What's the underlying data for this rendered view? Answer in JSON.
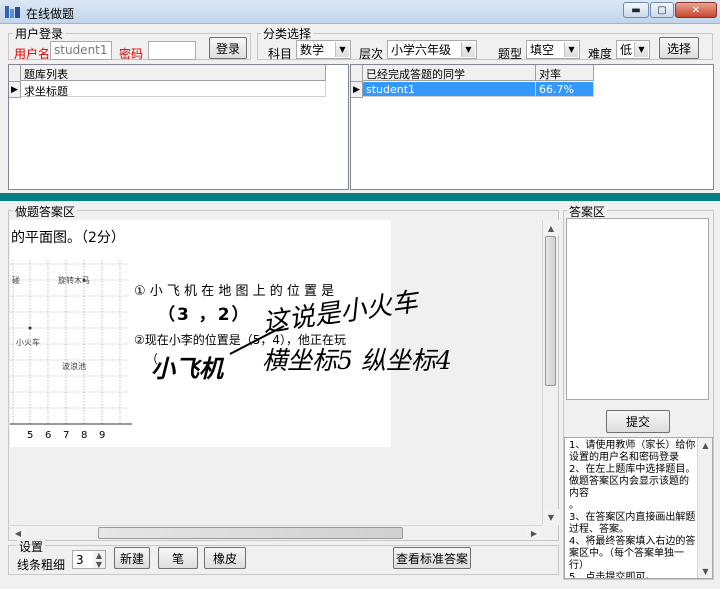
{
  "window": {
    "title": "在线做题",
    "min_glyph": "▬",
    "max_glyph": "▢",
    "close_glyph": "✕"
  },
  "login": {
    "group_label": "用户登录",
    "user_label": "用户名",
    "user_value": "student1",
    "password_label": "密码",
    "password_value": "",
    "login_button": "登录"
  },
  "filter": {
    "group_label": "分类选择",
    "subject_label": "科目",
    "subject_value": "数学",
    "level_label": "层次",
    "level_value": "小学六年级",
    "type_label": "题型",
    "type_value": "填空",
    "difficulty_label": "难度",
    "difficulty_value": "低",
    "select_button": "选择"
  },
  "question_bank": {
    "header": "题库列表",
    "rows": [
      "求坐标题"
    ]
  },
  "completed": {
    "headers": [
      "已经完成答题的同学",
      "对率"
    ],
    "rows": [
      {
        "name": "student1",
        "rate": "66.7%"
      }
    ]
  },
  "work_area": {
    "group_label": "做题答案区",
    "question_line1": "的平面图。（2分）",
    "map_label_top": "旋转木马",
    "map_label_left": "小火车",
    "map_label_mid": "波浪池",
    "map_label_corner": "碰",
    "x_ticks": [
      "5",
      "6",
      "7",
      "8",
      "9"
    ],
    "q1_text": "① 小 飞 机 在 地 图 上 的 位 置 是",
    "q1_answer": "（3 ，2）",
    "q2_text": "②现在小李的位置是（5，4），他正在玩",
    "q2_paren": "（",
    "hw_line1": "这说是小火车",
    "hw_line2": "小飞机",
    "hw_line3": "横坐标5 纵坐标4"
  },
  "settings": {
    "group_label": "设置",
    "line_width_label": "线条粗细",
    "line_width_value": "3",
    "new_button": "新建",
    "pen_button": "笔",
    "eraser_button": "橡皮",
    "view_answer_button": "查看标准答案"
  },
  "answer_area": {
    "group_label": "答案区",
    "answer_value": "",
    "submit_button": "提交",
    "instructions": "1、请使用教师（家长）给你设置的用户名和密码登录\n2、在左上题库中选择题目。做题答案区内会显示该题的内容\n。\n3、在答案区内直接画出解题过程、答案。\n4、将最终答案填入右边的答案区中。（每个答案单独一行）\n5、点击提交即可。"
  }
}
